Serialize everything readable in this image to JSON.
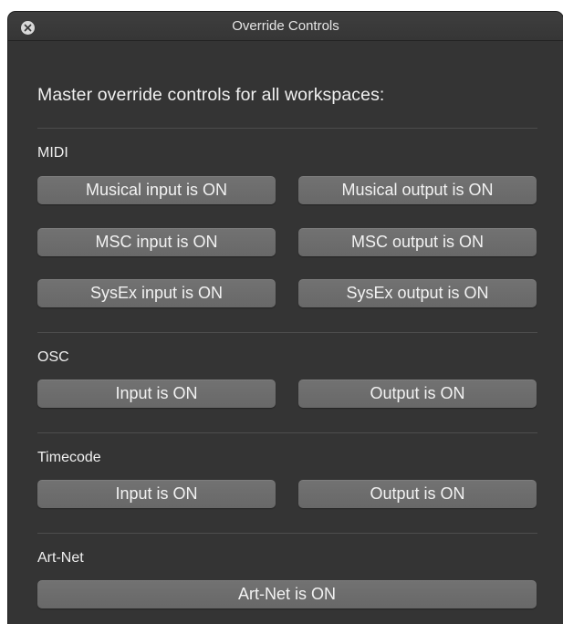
{
  "window": {
    "title": "Override Controls"
  },
  "intro": "Master override controls for all workspaces:",
  "sections": {
    "midi": {
      "label": "MIDI",
      "musical_input": "Musical input is ON",
      "musical_output": "Musical output is ON",
      "msc_input": "MSC input is ON",
      "msc_output": "MSC output is ON",
      "sysex_input": "SysEx input is ON",
      "sysex_output": "SysEx output is ON"
    },
    "osc": {
      "label": "OSC",
      "input": "Input is ON",
      "output": "Output is ON"
    },
    "timecode": {
      "label": "Timecode",
      "input": "Input is ON",
      "output": "Output is ON"
    },
    "artnet": {
      "label": "Art-Net",
      "toggle": "Art-Net is ON"
    }
  },
  "colors": {
    "window_bg": "#343434",
    "button_bg": "#6d6d6d",
    "text": "#f0f0f0",
    "divider": "#4d4d4d"
  }
}
